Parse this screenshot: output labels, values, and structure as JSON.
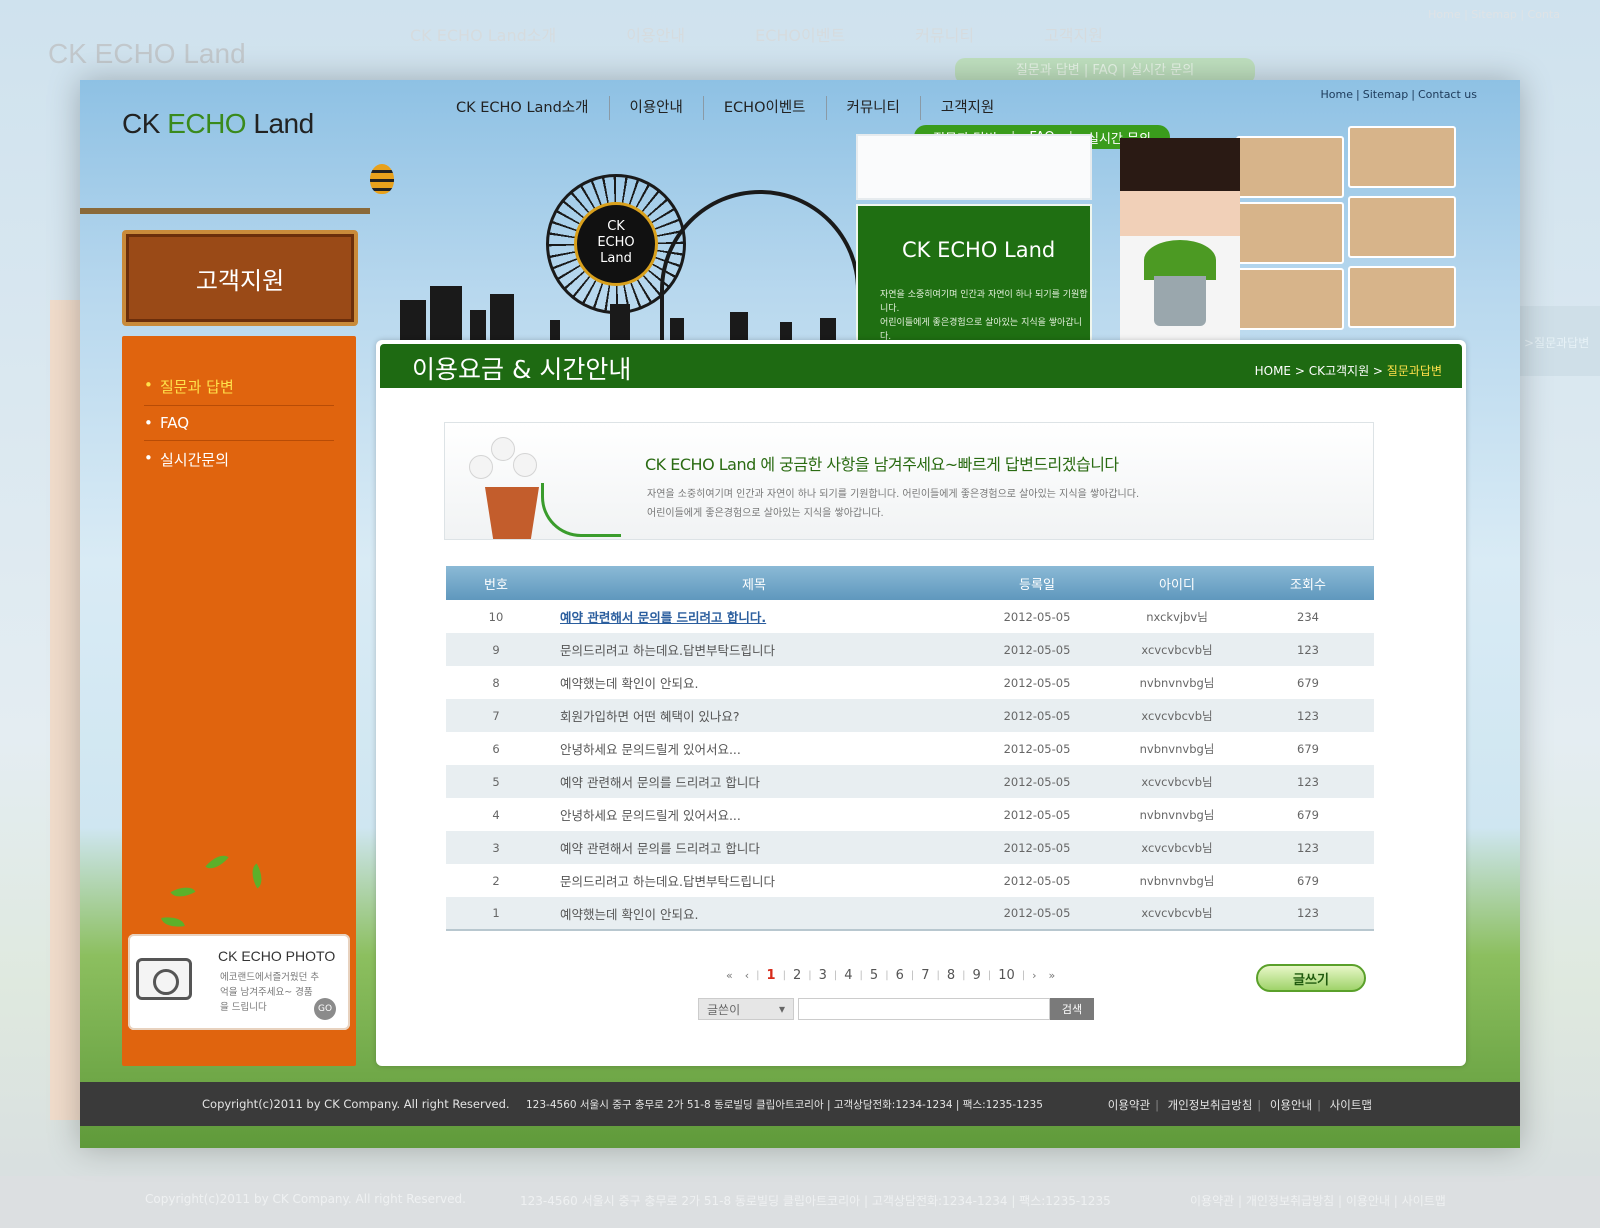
{
  "bg": {
    "logo": "CK ECHO Land",
    "nav": [
      "CK ECHO Land소개",
      "이용안내",
      "ECHO이벤트",
      "커뮤니티",
      "고객지원"
    ],
    "sub": "질문과 답변 | FAQ | 실시간 문의",
    "top": "Home | Sitemap | Conta",
    "right_tab": ">질문과답변",
    "foot_copy": "Copyright(c)2011 by CK Company. All right Reserved.",
    "foot_addr": "123-4560 서울시 중구 충무로 2가 51-8 동로빌딩 클립아트코리아 | 고객상담전화:1234-1234 | 팩스:1235-1235",
    "foot_links": "이용약관 | 개인정보취급방침 | 이용안내 | 사이트맵"
  },
  "header": {
    "logo_prefix": "CK ",
    "logo_accent": "ECHO",
    "logo_suffix": " Land",
    "nav": [
      "CK ECHO Land소개",
      "이용안내",
      "ECHO이벤트",
      "커뮤니티",
      "고객지원"
    ],
    "subnav": [
      "질문과 답변",
      "FAQ",
      "실시간 문의"
    ],
    "util": [
      "Home",
      "Sitemap",
      "Contact us"
    ]
  },
  "banner": {
    "wheel_text": "CK\nECHO\nLand",
    "card_title": "CK ECHO Land",
    "card_line1": "자연을 소중히여기며 인간과 자연이 하나 되기를 기원합니다.",
    "card_line2": "어린이들에게 좋은경험으로 살아있는 지식을 쌓아갑니다."
  },
  "sidebar": {
    "board_title": "고객지원",
    "items": [
      {
        "label": "질문과 답변",
        "active": true
      },
      {
        "label": "FAQ",
        "active": false
      },
      {
        "label": "실시간문의",
        "active": false
      }
    ],
    "photo_title": "CK ECHO PHOTO",
    "photo_desc": "에코랜드에서즐거웠던 추억을 남겨주세요~ 경품을 드립니다",
    "photo_go": "GO"
  },
  "content": {
    "title": "이용요금 & 시간안내",
    "breadcrumb_prefix": "HOME > CK고객지원 > ",
    "breadcrumb_current": "질문과답변",
    "intro_heading": "CK ECHO Land 에 궁금한 사항을 남겨주세요~빠르게 답변드리겠습니다",
    "intro_line1": "자연을 소중히여기며 인간과 자연이 하나 되기를 기원합니다. 어린이들에게 좋은경험으로 살아있는 지식을 쌓아갑니다.",
    "intro_line2": "어린이들에게 좋은경험으로 살아있는 지식을 쌓아갑니다.",
    "table": {
      "headers": [
        "번호",
        "제목",
        "등록일",
        "아이디",
        "조회수"
      ],
      "rows": [
        {
          "no": "10",
          "title": "예약 관련해서 문의를 드리려고 합니다.",
          "date": "2012-05-05",
          "id": "nxckvjbv님",
          "views": "234"
        },
        {
          "no": "9",
          "title": "문의드리려고 하는데요.답변부탁드립니다",
          "date": "2012-05-05",
          "id": "xcvcvbcvb님",
          "views": "123"
        },
        {
          "no": "8",
          "title": "예약했는데 확인이 안되요.",
          "date": "2012-05-05",
          "id": "nvbnvnvbg님",
          "views": "679"
        },
        {
          "no": "7",
          "title": "회원가입하면 어떤 혜택이 있나요?",
          "date": "2012-05-05",
          "id": "xcvcvbcvb님",
          "views": "123"
        },
        {
          "no": "6",
          "title": "안녕하세요 문의드릴게 있어서요...",
          "date": "2012-05-05",
          "id": "nvbnvnvbg님",
          "views": "679"
        },
        {
          "no": "5",
          "title": "예약 관련해서 문의를 드리려고 합니다",
          "date": "2012-05-05",
          "id": "xcvcvbcvb님",
          "views": "123"
        },
        {
          "no": "4",
          "title": "안녕하세요 문의드릴게 있어서요...",
          "date": "2012-05-05",
          "id": "nvbnvnvbg님",
          "views": "679"
        },
        {
          "no": "3",
          "title": "예약 관련해서 문의를 드리려고 합니다",
          "date": "2012-05-05",
          "id": "xcvcvbcvb님",
          "views": "123"
        },
        {
          "no": "2",
          "title": "문의드리려고 하는데요.답변부탁드립니다",
          "date": "2012-05-05",
          "id": "nvbnvnvbg님",
          "views": "679"
        },
        {
          "no": "1",
          "title": "예약했는데 확인이 안되요.",
          "date": "2012-05-05",
          "id": "xcvcvbcvb님",
          "views": "123"
        }
      ]
    },
    "pager": {
      "first": "«",
      "prev": "‹",
      "pages": [
        "1",
        "2",
        "3",
        "4",
        "5",
        "6",
        "7",
        "8",
        "9",
        "10"
      ],
      "current": "1",
      "next": "›",
      "last": "»"
    },
    "write_label": "글쓰기",
    "search_select": "글쓴이",
    "search_value": "",
    "search_button": "검색"
  },
  "footer": {
    "copyright": "Copyright(c)2011 by CK Company. All right Reserved.",
    "address": "123-4560 서울시 중구 충무로 2가 51-8 동로빌딩 클립아트코리아 | 고객상담전화:1234-1234 | 팩스:1235-1235",
    "links": [
      "이용약관",
      "개인정보취급방침",
      "이용안내",
      "사이트맵"
    ]
  },
  "colors": {
    "brand_green": "#1e6a12",
    "accent_orange": "#e0640e",
    "footer_dark": "#3a3a3a",
    "highlight_yellow": "#ffe14a"
  }
}
